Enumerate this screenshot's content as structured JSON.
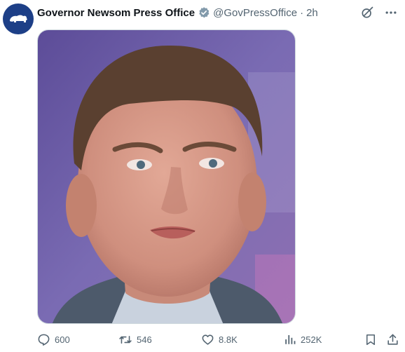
{
  "tweet": {
    "author_name": "Governor Newsom Press Office",
    "handle": "@GovPressOffice",
    "separator": "·",
    "time": "2h",
    "media_icon": "person-photo",
    "stats": {
      "replies": "600",
      "reposts": "546",
      "likes": "8.8K",
      "views": "252K"
    }
  },
  "colors": {
    "avatar_bg": "#1d3f87",
    "verified": "#829aab",
    "muted_text": "#536471",
    "photo_bg": "#6b5aa3"
  },
  "icons": {
    "avatar": "bear-icon",
    "verified": "verified-badge-icon",
    "grok": "grok-icon",
    "more": "more-icon",
    "reply": "reply-icon",
    "repost": "repost-icon",
    "like": "heart-icon",
    "views": "views-icon",
    "bookmark": "bookmark-icon",
    "share": "share-icon"
  }
}
